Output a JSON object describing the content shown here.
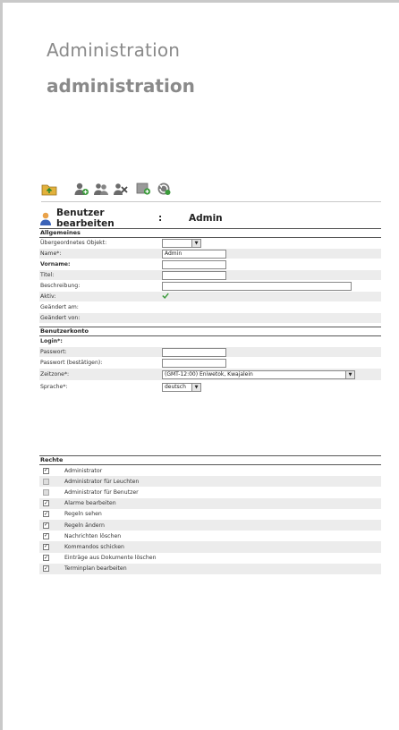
{
  "header": {
    "title": "Administration",
    "subtitle": "administration"
  },
  "toolbar": {
    "icons": [
      "folder-up-icon",
      "add-user-icon",
      "users-icon",
      "delete-users-icon",
      "add-item-icon",
      "refresh-icon"
    ]
  },
  "user_header": {
    "title": "Benutzer bearbeiten",
    "colon": ":",
    "value": "Admin"
  },
  "general": {
    "heading": "Allgemeines",
    "parent_label": "Übergeordnetes Objekt:",
    "name_label": "Name*:",
    "name_value": "Admin",
    "firstname_label": "Vorname:",
    "title_label": "Titel:",
    "description_label": "Beschreibung:",
    "active_label": "Aktiv:",
    "changed_at_label": "Geändert am:",
    "changed_by_label": "Geändert von:"
  },
  "account": {
    "heading": "Benutzerkonto",
    "login_label": "Login*:",
    "password_label": "Passwort:",
    "password_confirm_label": "Passwort (bestätigen):",
    "timezone_label": "Zeitzone*:",
    "timezone_value": "(GMT-12:00) Eniwetok, Kwajalein",
    "language_label": "Sprache*:",
    "language_value": "deutsch"
  },
  "rights": {
    "heading": "Rechte",
    "items": [
      {
        "label": "Administrator",
        "checked": true,
        "disabled": false
      },
      {
        "label": "Administrator für Leuchten",
        "checked": false,
        "disabled": true
      },
      {
        "label": "Administrator für Benutzer",
        "checked": false,
        "disabled": true
      },
      {
        "label": "Alarme bearbeiten",
        "checked": true,
        "disabled": false
      },
      {
        "label": "Regeln sehen",
        "checked": true,
        "disabled": false
      },
      {
        "label": "Regeln ändern",
        "checked": true,
        "disabled": false
      },
      {
        "label": "Nachrichten löschen",
        "checked": true,
        "disabled": false
      },
      {
        "label": "Kommandos schicken",
        "checked": true,
        "disabled": false
      },
      {
        "label": "Einträge aus Dokumente löschen",
        "checked": true,
        "disabled": false
      },
      {
        "label": "Terminplan bearbeiten",
        "checked": true,
        "disabled": false
      }
    ]
  }
}
